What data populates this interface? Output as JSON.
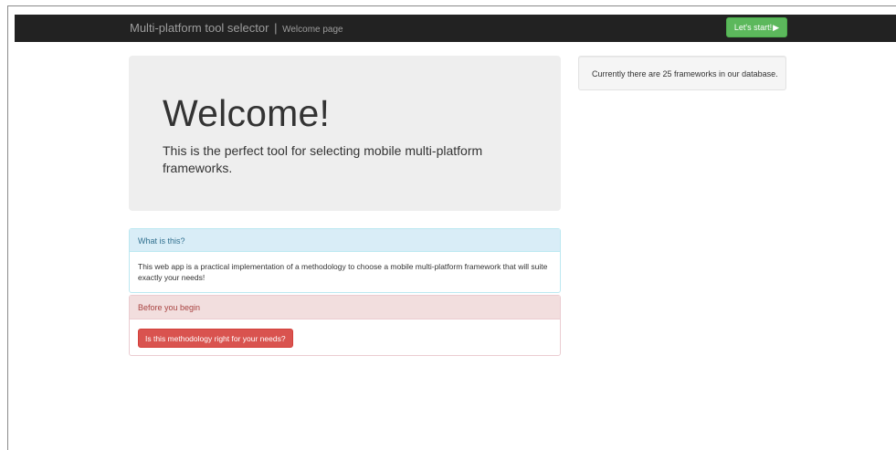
{
  "navbar": {
    "brand": "Multi-platform tool selector",
    "separator": "|",
    "subtitle": "Welcome page",
    "start_button": "Let's start!",
    "start_icon": "play-icon"
  },
  "jumbotron": {
    "title": "Welcome!",
    "text": "This is the perfect tool for selecting mobile multi-platform frameworks."
  },
  "info_panel": {
    "heading": "What is this?",
    "body": "This web app is a practical implementation of a methodology to choose a mobile multi-platform framework that will suite exactly your needs!"
  },
  "danger_panel": {
    "heading": "Before you begin",
    "button": "Is this methodology right for your needs?"
  },
  "sidebar": {
    "frameworks_count_text": "Currently there are 25 frameworks in our database."
  },
  "colors": {
    "navbar_bg": "#222222",
    "success": "#5cb85c",
    "danger": "#d9534f",
    "info_bg": "#d9edf7",
    "danger_bg": "#f2dede"
  }
}
